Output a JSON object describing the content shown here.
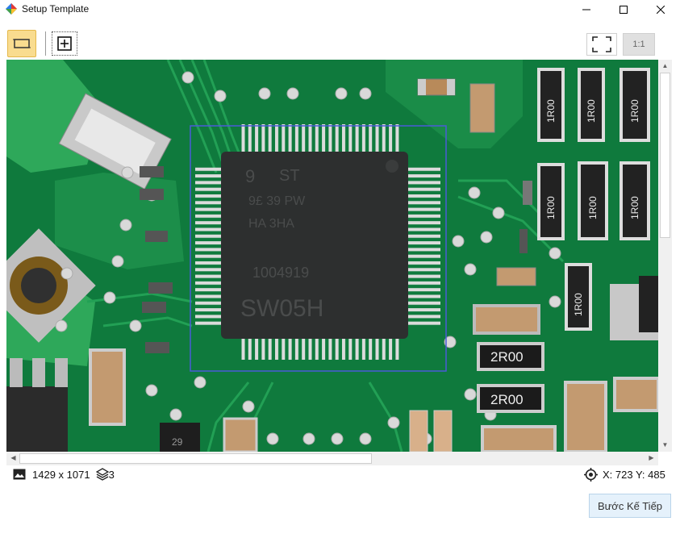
{
  "window": {
    "title": "Setup Template",
    "controls": [
      "minimize-icon",
      "maximize-icon",
      "close-icon"
    ]
  },
  "toolbar": {
    "rectangle_tool_icon": "rectangle-select-icon",
    "add_tool_icon": "add-box-icon",
    "fit_icon": "fullscreen-icon",
    "one_to_one_label": "1:1"
  },
  "board": {
    "chip_markings": [
      "9",
      "ST",
      "9£ 39 PW",
      "HA 3HA",
      "1004919",
      "SW05H"
    ],
    "resistor_labels": [
      "1R00",
      "1R00",
      "1R00",
      "1R00",
      "1R00",
      "1R00",
      "1R00",
      "2R00",
      "2R00"
    ],
    "other_text": "29",
    "colors": {
      "pcb": "#0f7a3d",
      "selection": "#4a5bd8"
    }
  },
  "status": {
    "image_icon": "image-icon",
    "image_size": "1429 x 1071",
    "layers_icon": "layers-icon",
    "layers_count": "3",
    "coord_icon": "crosshair-icon",
    "coords": "X: 723 Y: 485"
  },
  "next_button": {
    "label": "Bước Kế Tiếp"
  }
}
